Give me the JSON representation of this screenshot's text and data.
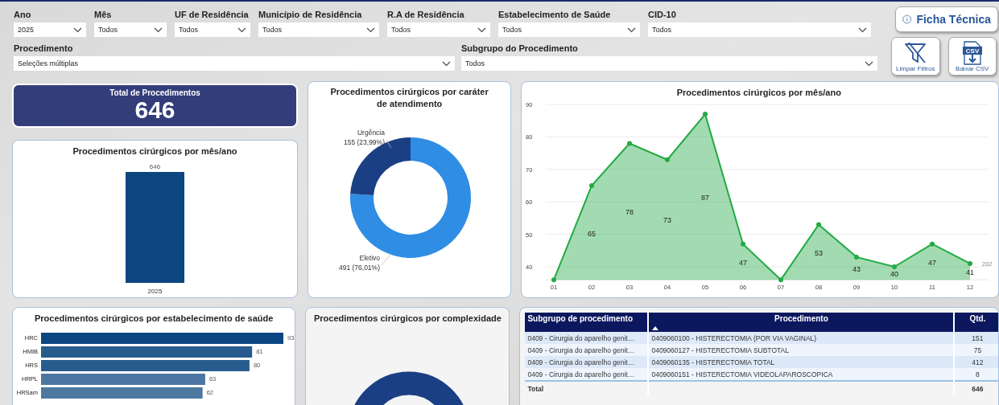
{
  "filters_row_1": [
    {
      "label": "Ano",
      "value": "2025"
    },
    {
      "label": "Mês",
      "value": "Todos"
    },
    {
      "label": "UF de Residência",
      "value": "Todos"
    },
    {
      "label": "Município de Residência",
      "value": "Todos"
    },
    {
      "label": "R.A de Residência",
      "value": "Todos"
    },
    {
      "label": "Estabelecimento de Saúde",
      "value": "Todos"
    },
    {
      "label": "CID-10",
      "value": "Todos"
    }
  ],
  "filters_row_2": [
    {
      "label": "Procedimento",
      "value": "Seleções múltiplas"
    },
    {
      "label": "Subgrupo do Procedimento",
      "value": "Todos"
    }
  ],
  "buttons": [
    {
      "kind": "info",
      "label": "Ficha Técnica"
    },
    {
      "kind": "clear_filters",
      "label": "Limpar Filtros"
    },
    {
      "kind": "download",
      "label": "Baixar CSV",
      "icon_text": "CSV"
    }
  ],
  "kpi": {
    "title": "Total de Procedimentos",
    "value": "646"
  },
  "year_chart": {
    "title": "Procedimentos cirúrgicos por mês/ano",
    "bars": [
      {
        "label": "2025",
        "value_label": "646"
      }
    ]
  },
  "character_chart": {
    "title": "Procedimentos cirúrgicos por caráter de atendimento",
    "chart_data": {
      "type": "donut",
      "categories": [
        "Eletivo",
        "Urgência"
      ],
      "values": [
        76.01,
        23.99
      ],
      "colors": [
        "#2f8de4",
        "#1b3f84"
      ],
      "value_labels": [
        "491 (76,01%)",
        "155 (23,99%)"
      ]
    }
  },
  "month_chart": {
    "title": "Procedimentos cirúrgicos por mês/ano",
    "legend_text": "202",
    "chart_data": {
      "type": "area",
      "categories": [
        "01",
        "02",
        "03",
        "04",
        "05",
        "06",
        "07",
        "08",
        "09",
        "10",
        "11",
        "12"
      ],
      "series": [
        {
          "color": "#22aa44",
          "values": [
            36,
            65,
            78,
            73,
            87,
            47,
            36,
            53,
            43,
            40,
            47,
            41
          ]
        }
      ],
      "grid": true,
      "ylim": [
        36,
        90
      ],
      "yticks": [
        40,
        50,
        60,
        70,
        80,
        90
      ],
      "value_labels": [
        null,
        "65",
        "78",
        "73",
        "87",
        "47",
        null,
        "53",
        "43",
        "40",
        "47",
        "41"
      ]
    }
  },
  "establishment_chart": {
    "title": "Procedimentos cirúrgicos por estabelecimento de saúde",
    "chart_data": {
      "type": "bar",
      "orientation": "horizontal",
      "categories": [
        "HRC",
        "HMIB",
        "HRS",
        "HRPL",
        "HRSam"
      ],
      "series": [
        {
          "values": [
            93,
            81,
            80,
            63,
            62
          ]
        }
      ],
      "colors": [
        "#0b4680",
        "#275b8e",
        "#285c8f",
        "#4b76a1",
        "#4d78a2"
      ],
      "data_labels": true
    }
  },
  "complexity_chart": {
    "title": "Procedimentos cirúrgicos por complexidade"
  },
  "table": {
    "columns": [
      {
        "label": "Subgrupo de procedimento",
        "sorted": false
      },
      {
        "label": "Procedimento",
        "sorted": true
      },
      {
        "label": "Qtd.",
        "sorted": false
      }
    ],
    "rows": [
      [
        "0409 - Cirurgia do aparelho genit…",
        "0409060100 - HISTERECTOMIA (POR VIA VAGINAL)",
        "151"
      ],
      [
        "0409 - Cirurgia do aparelho genit…",
        "0409060127 - HISTERECTOMIA SUBTOTAL",
        "75"
      ],
      [
        "0409 - Cirurgia do aparelho genit…",
        "0409060135 - HISTERECTOMIA TOTAL",
        "412"
      ],
      [
        "0409 - Cirurgia do aparelho genit…",
        "0409060151 - HISTERECTOMIA VIDEOLAPAROSCOPICA",
        "8"
      ]
    ],
    "total": {
      "label": "Total",
      "value": "646"
    }
  }
}
